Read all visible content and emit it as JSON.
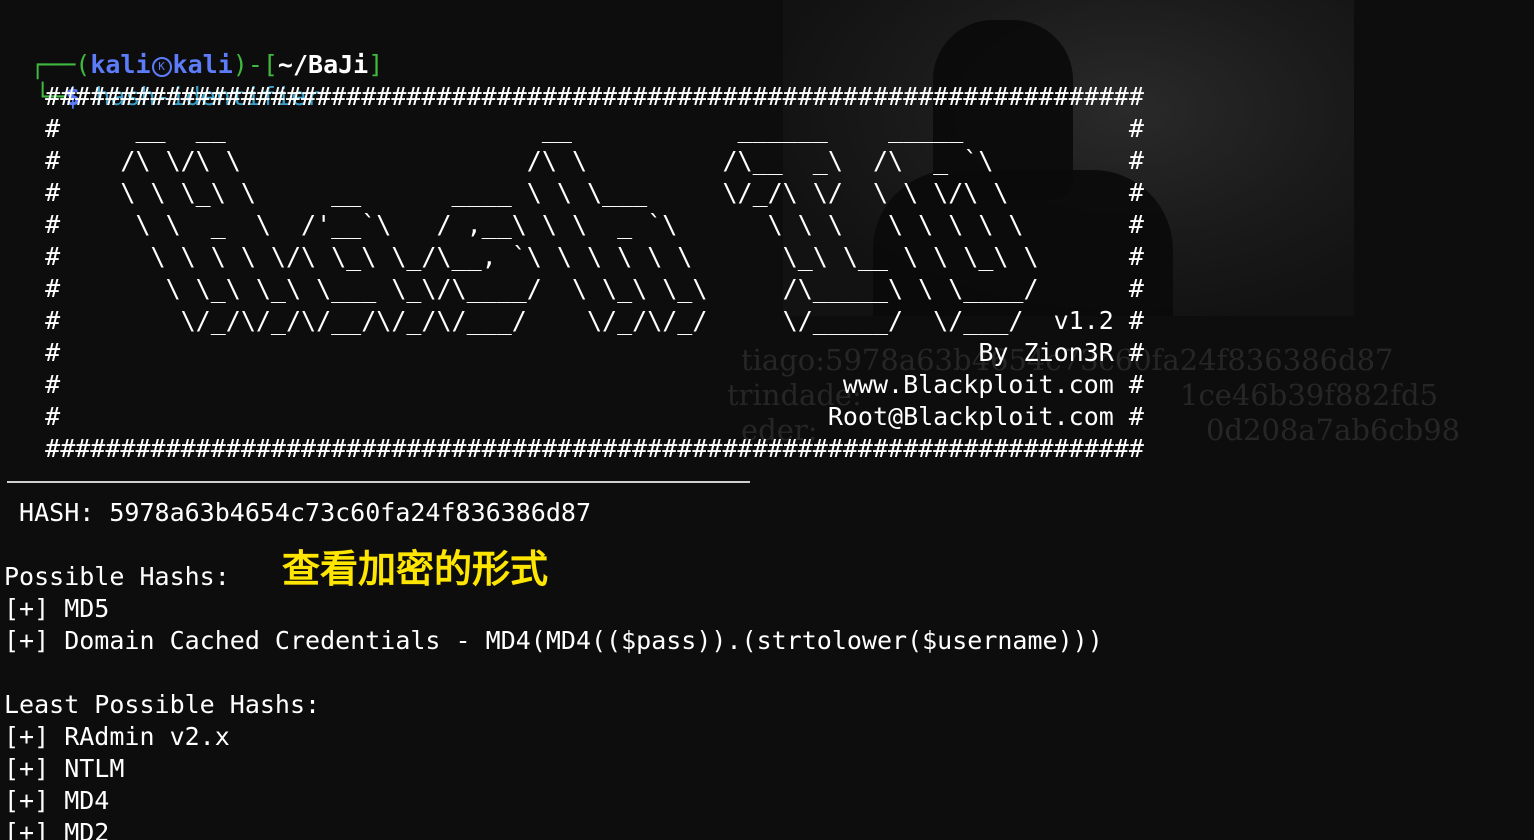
{
  "prompt": {
    "corner_top": "┌──",
    "open_paren": "(",
    "user": "kali",
    "host": "kali",
    "close_sep": ")-[",
    "dir": "~/BaJi",
    "close_bracket": "]",
    "corner_bottom": "└─",
    "dollar": "$ ",
    "command": "hash-identifier",
    "icon": "kali-dragon-icon"
  },
  "banner_lines": [
    "   #########################################################################",
    "   #     __  __                     __           ______    _____           #",
    "   #    /\\ \\/\\ \\                   /\\ \\         /\\__  _\\  /\\  _ `\\         #",
    "   #    \\ \\ \\_\\ \\     __      ____ \\ \\ \\___     \\/_/\\ \\/  \\ \\ \\/\\ \\        #",
    "   #     \\ \\  _  \\  /'__`\\   / ,__\\ \\ \\  _ `\\      \\ \\ \\   \\ \\ \\ \\ \\       #",
    "   #      \\ \\ \\ \\ \\/\\ \\_\\ \\_/\\__, `\\ \\ \\ \\ \\ \\      \\_\\ \\__ \\ \\ \\_\\ \\      #",
    "   #       \\ \\_\\ \\_\\ \\___ \\_\\/\\____/  \\ \\_\\ \\_\\     /\\_____\\ \\ \\____/      #",
    "   #        \\/_/\\/_/\\/__/\\/_/\\/___/    \\/_/\\/_/     \\/_____/  \\/___/  v1.2 #",
    "   #                                                             By Zion3R #",
    "   #                                                    www.Blackploit.com #",
    "   #                                                   Root@Blackploit.com #",
    "   #########################################################################"
  ],
  "bg_text": [
    "tiago:5978a63b4654c73c60fa24f836386d87",
    "trindade:",
    "eder:"
  ],
  "bg_text_right": [
    "",
    "1ce46b39f882fd5",
    "0d208a7ab6cb98"
  ],
  "hash_line": " HASH: 5978a63b4654c73c60fa24f836386d87",
  "possible_label": "Possible Hashs:",
  "annotation": "查看加密的形式",
  "possible_hashes": [
    "[+] MD5",
    "[+] Domain Cached Credentials - MD4(MD4(($pass)).(strtolower($username)))"
  ],
  "least_label": "Least Possible Hashs:",
  "least_hashes": [
    "[+] RAdmin v2.x",
    "[+] NTLM",
    "[+] MD4",
    "[+] MD2"
  ],
  "colors": {
    "background": "#0d0d0d",
    "prompt_green": "#3fb93f",
    "prompt_blue": "#5c7cfa",
    "command": "#3aa0c8",
    "annotation": "#ffe600"
  }
}
